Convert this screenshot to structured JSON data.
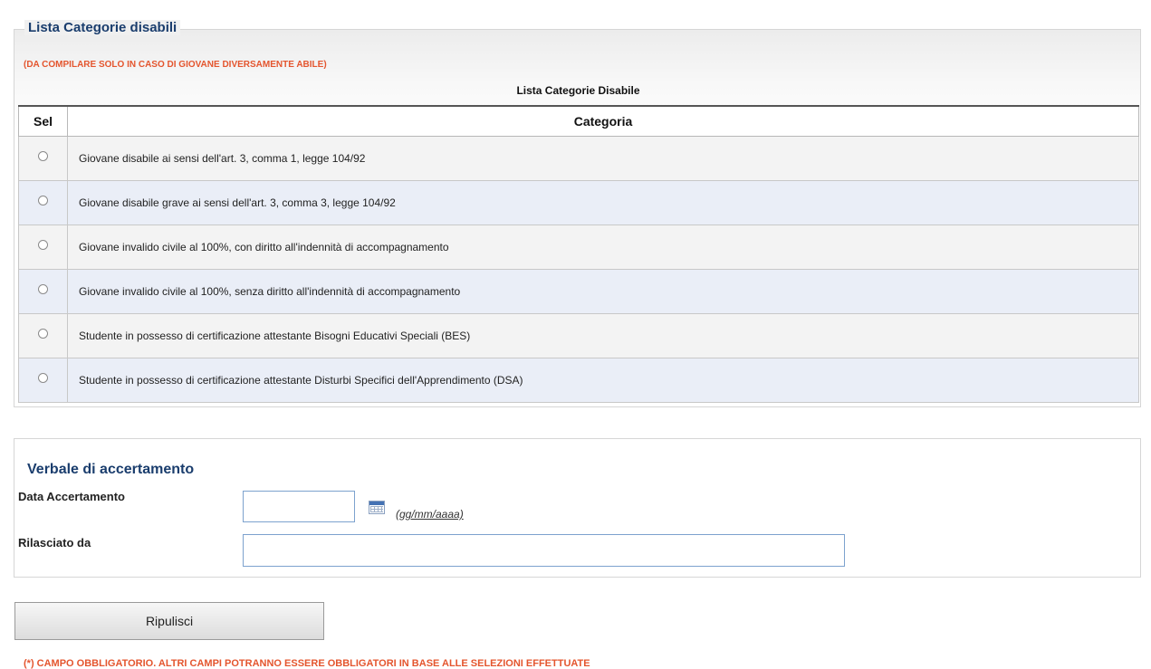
{
  "section1": {
    "legend": "Lista Categorie disabili",
    "note": "(DA COMPILARE SOLO IN CASO DI GIOVANE DIVERSAMENTE ABILE)",
    "table_caption": "Lista Categorie Disabile",
    "columns": [
      "Sel",
      "Categoria"
    ],
    "rows": [
      {
        "label": "Giovane disabile ai sensi dell'art. 3, comma 1, legge 104/92",
        "selected": false
      },
      {
        "label": "Giovane disabile grave ai sensi dell'art. 3, comma 3, legge 104/92",
        "selected": false
      },
      {
        "label": "Giovane invalido civile al 100%, con diritto all'indennità di accompagnamento",
        "selected": false
      },
      {
        "label": "Giovane invalido civile al 100%, senza diritto all'indennità di accompagnamento",
        "selected": false
      },
      {
        "label": "Studente in possesso di certificazione attestante Bisogni Educativi Speciali (BES)",
        "selected": false
      },
      {
        "label": "Studente in possesso di certificazione attestante Disturbi Specifici dell'Apprendimento (DSA)",
        "selected": false
      }
    ]
  },
  "section2": {
    "title": "Verbale di accertamento",
    "date_label": "Data Accertamento",
    "date_value": "",
    "date_format": "(gg/mm/aaaa)",
    "issued_label": "Rilasciato da",
    "issued_value": ""
  },
  "actions": {
    "clear_label": "Ripulisci"
  },
  "footnote": "(*) CAMPO OBBLIGATORIO. ALTRI CAMPI POTRANNO ESSERE OBBLIGATORI IN BASE ALLE SELEZIONI EFFETTUATE",
  "colors": {
    "heading": "#1a3d6d",
    "warning": "#e4552e",
    "row_alt": "#eaeef7",
    "input_border": "#7da2ce"
  }
}
